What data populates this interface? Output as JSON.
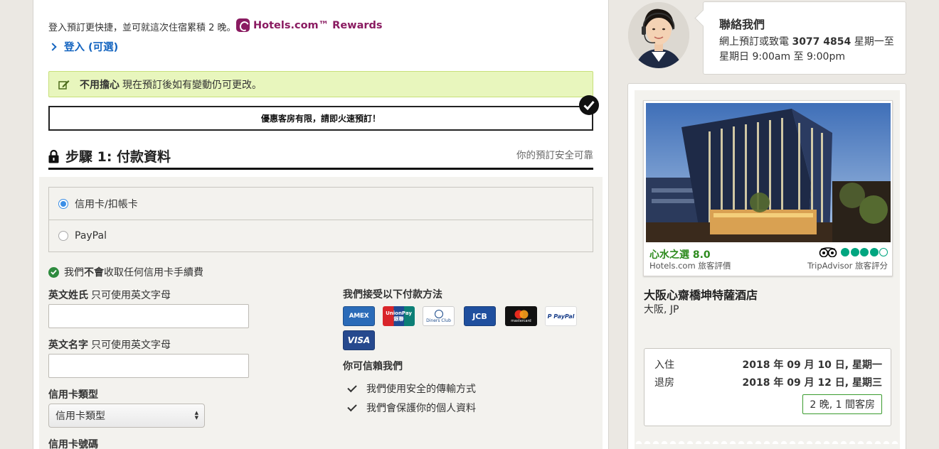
{
  "signin": {
    "prompt": "登入預訂更快捷，並可就這次住宿累積 2 晚。",
    "rewards_label": "Hotels.com™ Rewards",
    "link_label": "登入 (可選)"
  },
  "notice": {
    "bold": "不用擔心",
    "text": "現在預訂後如有變動仍可更改。"
  },
  "urgency": "優惠客房有限，請即火速預訂！",
  "step": {
    "title": "步驟 1: 付款資料",
    "secure_note": "你的預訂安全可靠"
  },
  "payment_options": [
    {
      "label": "信用卡/扣帳卡",
      "selected": true
    },
    {
      "label": "PayPal",
      "selected": false
    }
  ],
  "no_fee": {
    "prefix": "我們",
    "bold": "不會",
    "suffix": "收取任何信用卡手續費"
  },
  "form": {
    "last_name_label": "英文姓氏",
    "last_name_hint": "只可使用英文字母",
    "last_name_value": "",
    "first_name_label": "英文名字",
    "first_name_hint": "只可使用英文字母",
    "first_name_value": "",
    "card_type_label": "信用卡類型",
    "card_type_value": "信用卡類型",
    "card_number_label": "信用卡號碼"
  },
  "accepted": {
    "title": "我們接受以下付款方法",
    "cards": [
      {
        "name": "AMEX",
        "icon": "amex-icon"
      },
      {
        "name": "UnionPay 銀聯",
        "icon": "unionpay-icon"
      },
      {
        "name": "Diners Club",
        "icon": "diners-icon"
      },
      {
        "name": "JCB",
        "icon": "jcb-icon"
      },
      {
        "name": "mastercard",
        "icon": "mastercard-icon"
      },
      {
        "name": "PayPal",
        "icon": "paypal-icon"
      },
      {
        "name": "VISA",
        "icon": "visa-icon"
      }
    ]
  },
  "trust": {
    "title": "你可信賴我們",
    "items": [
      "我們使用安全的傳輸方式",
      "我們會保護你的個人資料"
    ]
  },
  "contact": {
    "title": "聯絡我們",
    "line1_prefix": "網上預訂或致電",
    "phone": "3077 4854",
    "line1_suffix": "星期一至",
    "line2": "星期日 9:00am 至 9:00pm"
  },
  "hotel": {
    "guest_score": "心水之選 8.0",
    "guest_score_source": "Hotels.com 旅客評價",
    "tripadvisor_rating": 4,
    "tripadvisor_source": "TripAdvisor 旅客評分",
    "name": "大阪心齋橋坤特薩酒店",
    "location": "大阪, JP"
  },
  "stay": {
    "checkin_label": "入住",
    "checkin_date": "2018 年 09 月 10 日, 星期一",
    "checkout_label": "退房",
    "checkout_date": "2018 年 09 月 12 日, 星期三",
    "summary": "2 晚, 1 間客房"
  },
  "colors": {
    "brand": "#8a1b61",
    "link": "#1565c0",
    "notice_bg": "#e8f6bd",
    "score_green": "#2e8b1e",
    "tripadvisor": "#00a680"
  }
}
